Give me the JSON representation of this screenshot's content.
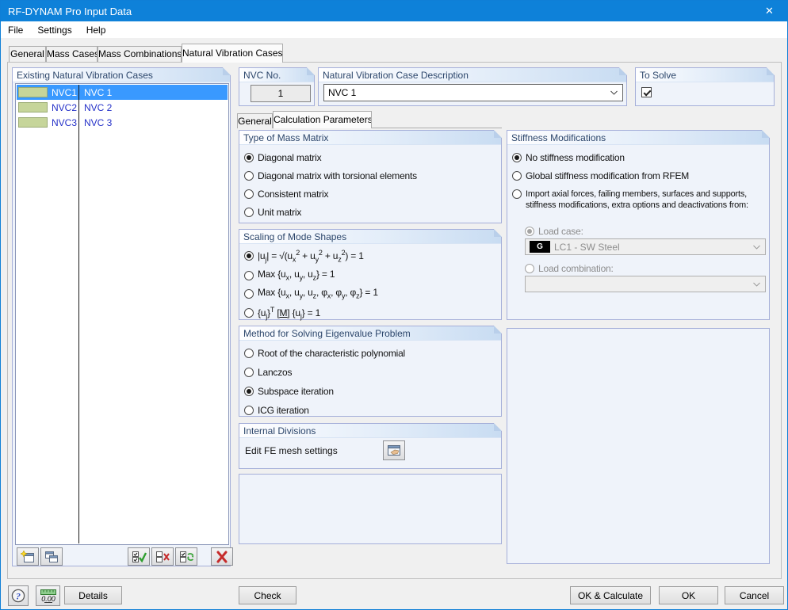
{
  "window": {
    "title": "RF-DYNAM Pro Input Data",
    "close_glyph": "✕"
  },
  "menu": {
    "items": [
      "File",
      "Settings",
      "Help"
    ]
  },
  "tabs": [
    "General",
    "Mass Cases",
    "Mass Combinations",
    "Natural Vibration Cases"
  ],
  "active_tab": "Natural Vibration Cases",
  "left_panel": {
    "title": "Existing Natural Vibration Cases",
    "swatch_color": "#C6D59A",
    "rows": [
      {
        "id": "NVC1",
        "description": "NVC 1",
        "selected": true
      },
      {
        "id": "NVC2",
        "description": "NVC 2",
        "selected": false
      },
      {
        "id": "NVC3",
        "description": "NVC 3",
        "selected": false
      }
    ],
    "toolbar_icons": [
      "new-case-icon",
      "copy-case-icon",
      "check-all-icon",
      "uncheck-all-icon",
      "invert-selection-icon",
      "delete-case-icon"
    ]
  },
  "fields": {
    "nvc_no": {
      "label": "NVC No.",
      "value": "1"
    },
    "description": {
      "label": "Natural Vibration Case Description",
      "value": "NVC 1"
    },
    "to_solve": {
      "label": "To Solve",
      "checked": true
    }
  },
  "inner_tabs": [
    "General",
    "Calculation Parameters"
  ],
  "active_inner_tab": "Calculation Parameters",
  "mass_matrix": {
    "title": "Type of Mass Matrix",
    "selected_index": 0,
    "options": [
      "Diagonal matrix",
      "Diagonal matrix with torsional elements",
      "Consistent matrix",
      "Unit matrix"
    ]
  },
  "mode_scaling": {
    "title": "Scaling of Mode Shapes",
    "selected_index": 0,
    "options_html": [
      "|u<sub>j</sub>| = √(u<sub>x</sub><sup>2</sup> + u<sub>y</sub><sup>2</sup> + u<sub>z</sub><sup>2</sup>) = 1",
      "Max {u<sub>x</sub>, u<sub>y</sub>, u<sub>z</sub>} = 1",
      "Max {u<sub>x</sub>, u<sub>y</sub>, u<sub>z</sub>, φ<sub>x</sub>, φ<sub>y</sub>, φ<sub>z</sub>} = 1",
      "{u<sub>j</sub>}<sup>T</sup> <u>[M]</u> {u<sub>j</sub>} = 1"
    ]
  },
  "eigen_method": {
    "title": "Method for Solving Eigenvalue Problem",
    "selected_index": 2,
    "options": [
      "Root of the characteristic polynomial",
      "Lanczos",
      "Subspace iteration",
      "ICG iteration"
    ]
  },
  "internal_divisions": {
    "title": "Internal Divisions",
    "edit_label": "Edit FE mesh settings"
  },
  "stiffness": {
    "title": "Stiffness Modifications",
    "selected_index": 0,
    "option1": "No stiffness modification",
    "option2": "Global stiffness modification from RFEM",
    "option3_html": "Import axial forces, failing members, surfaces and supports,<br>stiffness modifications, extra options and deactivations from:",
    "load_case": {
      "label": "Load case:",
      "badge": "G",
      "value": "LC1 - SW Steel",
      "enabled": false
    },
    "load_combination": {
      "label": "Load combination:",
      "value": "",
      "enabled": false
    }
  },
  "footer": {
    "details": "Details",
    "check": "Check",
    "ok_calculate": "OK & Calculate",
    "ok": "OK",
    "cancel": "Cancel",
    "units": "0.00"
  },
  "colors": {
    "titlebar": "#0E81D9",
    "selection": "#3999FF",
    "list_text": "#2430C8",
    "swatch": "#C6D59A",
    "group_border": "#A5AFD9",
    "group_bg": "#EFF3FA",
    "header_text": "#2C466B",
    "disabled_text": "#8D8D8D"
  }
}
